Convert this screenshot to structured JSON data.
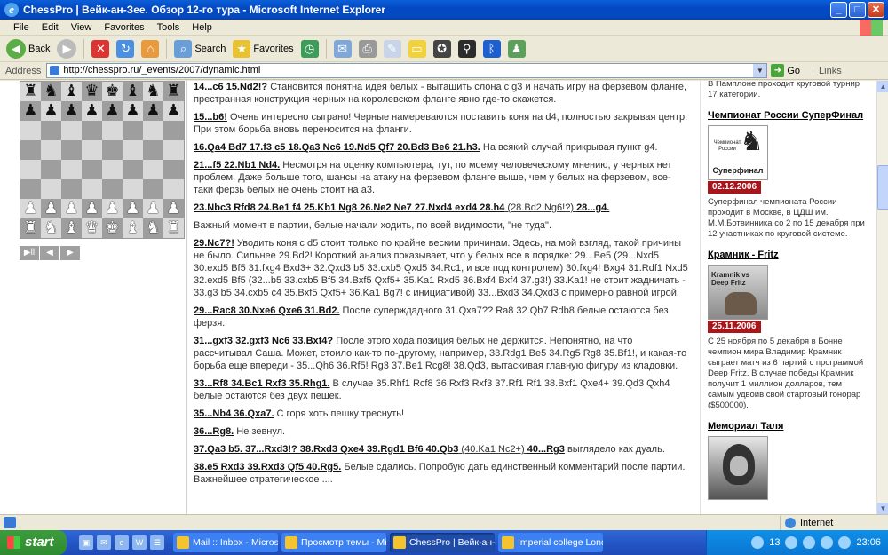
{
  "window": {
    "title": "ChessPro | Вейк-ан-Зее. Обзор 12-го тура - Microsoft Internet Explorer"
  },
  "menu": [
    "File",
    "Edit",
    "View",
    "Favorites",
    "Tools",
    "Help"
  ],
  "toolbar": {
    "back": "Back",
    "search": "Search",
    "favorites": "Favorites"
  },
  "address": {
    "label": "Address",
    "url": "http://chesspro.ru/_events/2007/dynamic.html",
    "go": "Go",
    "links": "Links"
  },
  "board": {
    "rows": [
      [
        "bR",
        "bN",
        "bB",
        "bQ",
        "bK",
        "bB",
        "bN",
        "bR"
      ],
      [
        "bP",
        "bP",
        "bP",
        "bP",
        "bP",
        "bP",
        "bP",
        "bP"
      ],
      [
        "",
        "",
        "",
        "",
        "",
        "",
        "",
        ""
      ],
      [
        "",
        "",
        "",
        "",
        "",
        "",
        "",
        ""
      ],
      [
        "",
        "",
        "",
        "",
        "",
        "",
        "",
        ""
      ],
      [
        "",
        "",
        "",
        "",
        "",
        "",
        "",
        ""
      ],
      [
        "wP",
        "wP",
        "wP",
        "wP",
        "wP",
        "wP",
        "wP",
        "wP"
      ],
      [
        "wR",
        "wN",
        "wB",
        "wQ",
        "wK",
        "wB",
        "wN",
        "wR"
      ]
    ],
    "nav": [
      "▶ll",
      "◀",
      "▶"
    ]
  },
  "content": {
    "p1": {
      "m": "14...c6 15.Nd2!?",
      "t": " Становится понятна идея белых - вытащить слона с g3 и начать игру на ферзевом фланге, престранная конструкция черных на королевском фланге явно где-то скажется."
    },
    "p2": {
      "m": "15...b6!",
      "t": " Очень интересно сыграно! Черные намереваются поставить коня на d4, полностью закрывая центр. При этом борьба вновь переносится на фланги."
    },
    "p3": {
      "m": "16.Qa4 Bd7 17.f3 c5 18.Qa3 Nc6 19.Nd5 Qf7 20.Bd3 Be6 21.h3.",
      "t": " На всякий случай прикрывая пункт g4."
    },
    "p4": {
      "m": "21...f5 22.Nb1 Nd4.",
      "t": " Несмотря на оценку компьютера, тут, по моему человеческому мнению, у черных нет проблем. Даже больше того, шансы на атаку на ферзевом фланге выше, чем у белых на ферзевом, все-таки ферзь белых не очень стоит на a3."
    },
    "p5": {
      "m": "23.Nbc3 Rfd8 24.Be1 f4 25.Kb1 Ng8 26.Ne2 Ne7 27.Nxd4 exd4 28.h4",
      "t": " (28.Bd2 Ng6!?) ",
      "m2": "28...g4."
    },
    "p6": {
      "t": "Важный момент в партии, белые начали ходить, по всей видимости, \"не туда\"."
    },
    "p7": {
      "m": "29.Nc7?!",
      "t": " Уводить коня с d5 стоит только по крайне веским причинам. Здесь, на мой взгляд, такой причины не было. Сильнее 29.Bd2! Короткий анализ показывает, что у белых все в порядке: 29...Be5 (29...Nxd5 30.exd5 Bf5 31.fxg4 Bxd3+ 32.Qxd3 b5 33.cxb5 Qxd5 34.Rc1, и все под контролем) 30.fxg4! Bxg4 31.Rdf1 Nxd5 32.exd5 Bf5 (32...b5 33.cxb5 Bf5 34.Bxf5 Qxf5+ 35.Ka1 Rxd5 36.Bxf4 Bxf4 37.g3!) 33.Ka1! не стоит жадничать - 33.g3 b5 34.cxb5 c4 35.Bxf5 Qxf5+ 36.Ka1 Bg7! с инициативой) 33...Bxd3 34.Qxd3 с примерно равной игрой."
    },
    "p8": {
      "m": "29...Rac8 30.Nxe6 Qxe6 31.Bd2.",
      "t": " После суперждадного 31.Qxa7?? Ra8 32.Qb7 Rdb8 белые остаются без ферзя."
    },
    "p9": {
      "m": "31...gxf3 32.gxf3 Nc6 33.Bxf4?",
      "t": " После этого хода позиция белых не держится. Непонятно, на что рассчитывал Саша. Может, стоило как-то по-другому, например, 33.Rdg1 Be5 34.Rg5 Rg8 35.Bf1!, и какая-то борьба еще впереди - 35...Qh6 36.Rf5! Rg3 37.Be1 Rcg8! 38.Qd3, вытаскивая главную фигуру из кладовки."
    },
    "p10": {
      "m": "33...Rf8 34.Bc1 Rxf3 35.Rhg1.",
      "t": " В случае 35.Rhf1 Rcf8 36.Rxf3 Rxf3 37.Rf1 Rf1 38.Bxf1 Qxe4+ 39.Qd3 Qxh4 белые остаются без двух пешек."
    },
    "p11": {
      "m": "35...Nb4 36.Qxa7.",
      "t": " С горя хоть пешку треснуть!"
    },
    "p12": {
      "m": "36...Rg8.",
      "t": " Не зевнул."
    },
    "p13": {
      "m": "37.Qa3 b5. 37...Rxd3!? 38.Rxd3 Qxe4 39.Rgd1 Bf6 40.Qb3",
      "t": " (40.Ka1 Nc2+) ",
      "m2": "40...Rg3",
      "t2": " выглядело как дуаль."
    },
    "p14": {
      "m": "38.e5 Rxd3 39.Rxd3 Qf5 40.Rg5.",
      "t": " Белые сдались. Попробую дать единственный комментарий после партии. Важнейшее стратегическое ...."
    }
  },
  "sidebar": {
    "top_text": "В Памплоне проходит круговой турнир 17 категории.",
    "n1": {
      "title": "Чемпионат России СуперФинал",
      "thumb": "Суперфинал",
      "thumb_top": "Чемпионат России",
      "date": "02.12.2006",
      "text": "Суперфинал чемпионата России проходит в Москве, в ЦДШ им. М.М.Ботвинника со 2 по 15 декабря при 12 участниках по круговой системе."
    },
    "n2": {
      "title": "Крамник - Fritz",
      "thumb": "Kramnik vs Deep Fritz",
      "date": "25.11.2006",
      "text": "С 25 ноября по 5 декабря в Бонне чемпион мира Владимир Крамник сыграет матч из 6 партий с программой Deep Fritz. В случае победы Крамник получит 1 миллион долларов, тем самым удвоив свой стартовый гонорар ($500000)."
    },
    "n3": {
      "title": "Мемориал Таля"
    }
  },
  "status": {
    "zone": "Internet"
  },
  "taskbar": {
    "start": "start",
    "tasks": [
      "Mail :: Inbox - Micros...",
      "Просмотр темы - Mic...",
      "ChessPro | Вейк-ан-...",
      "Imperial college London"
    ],
    "tray_count": "13",
    "clock": "23:06"
  }
}
